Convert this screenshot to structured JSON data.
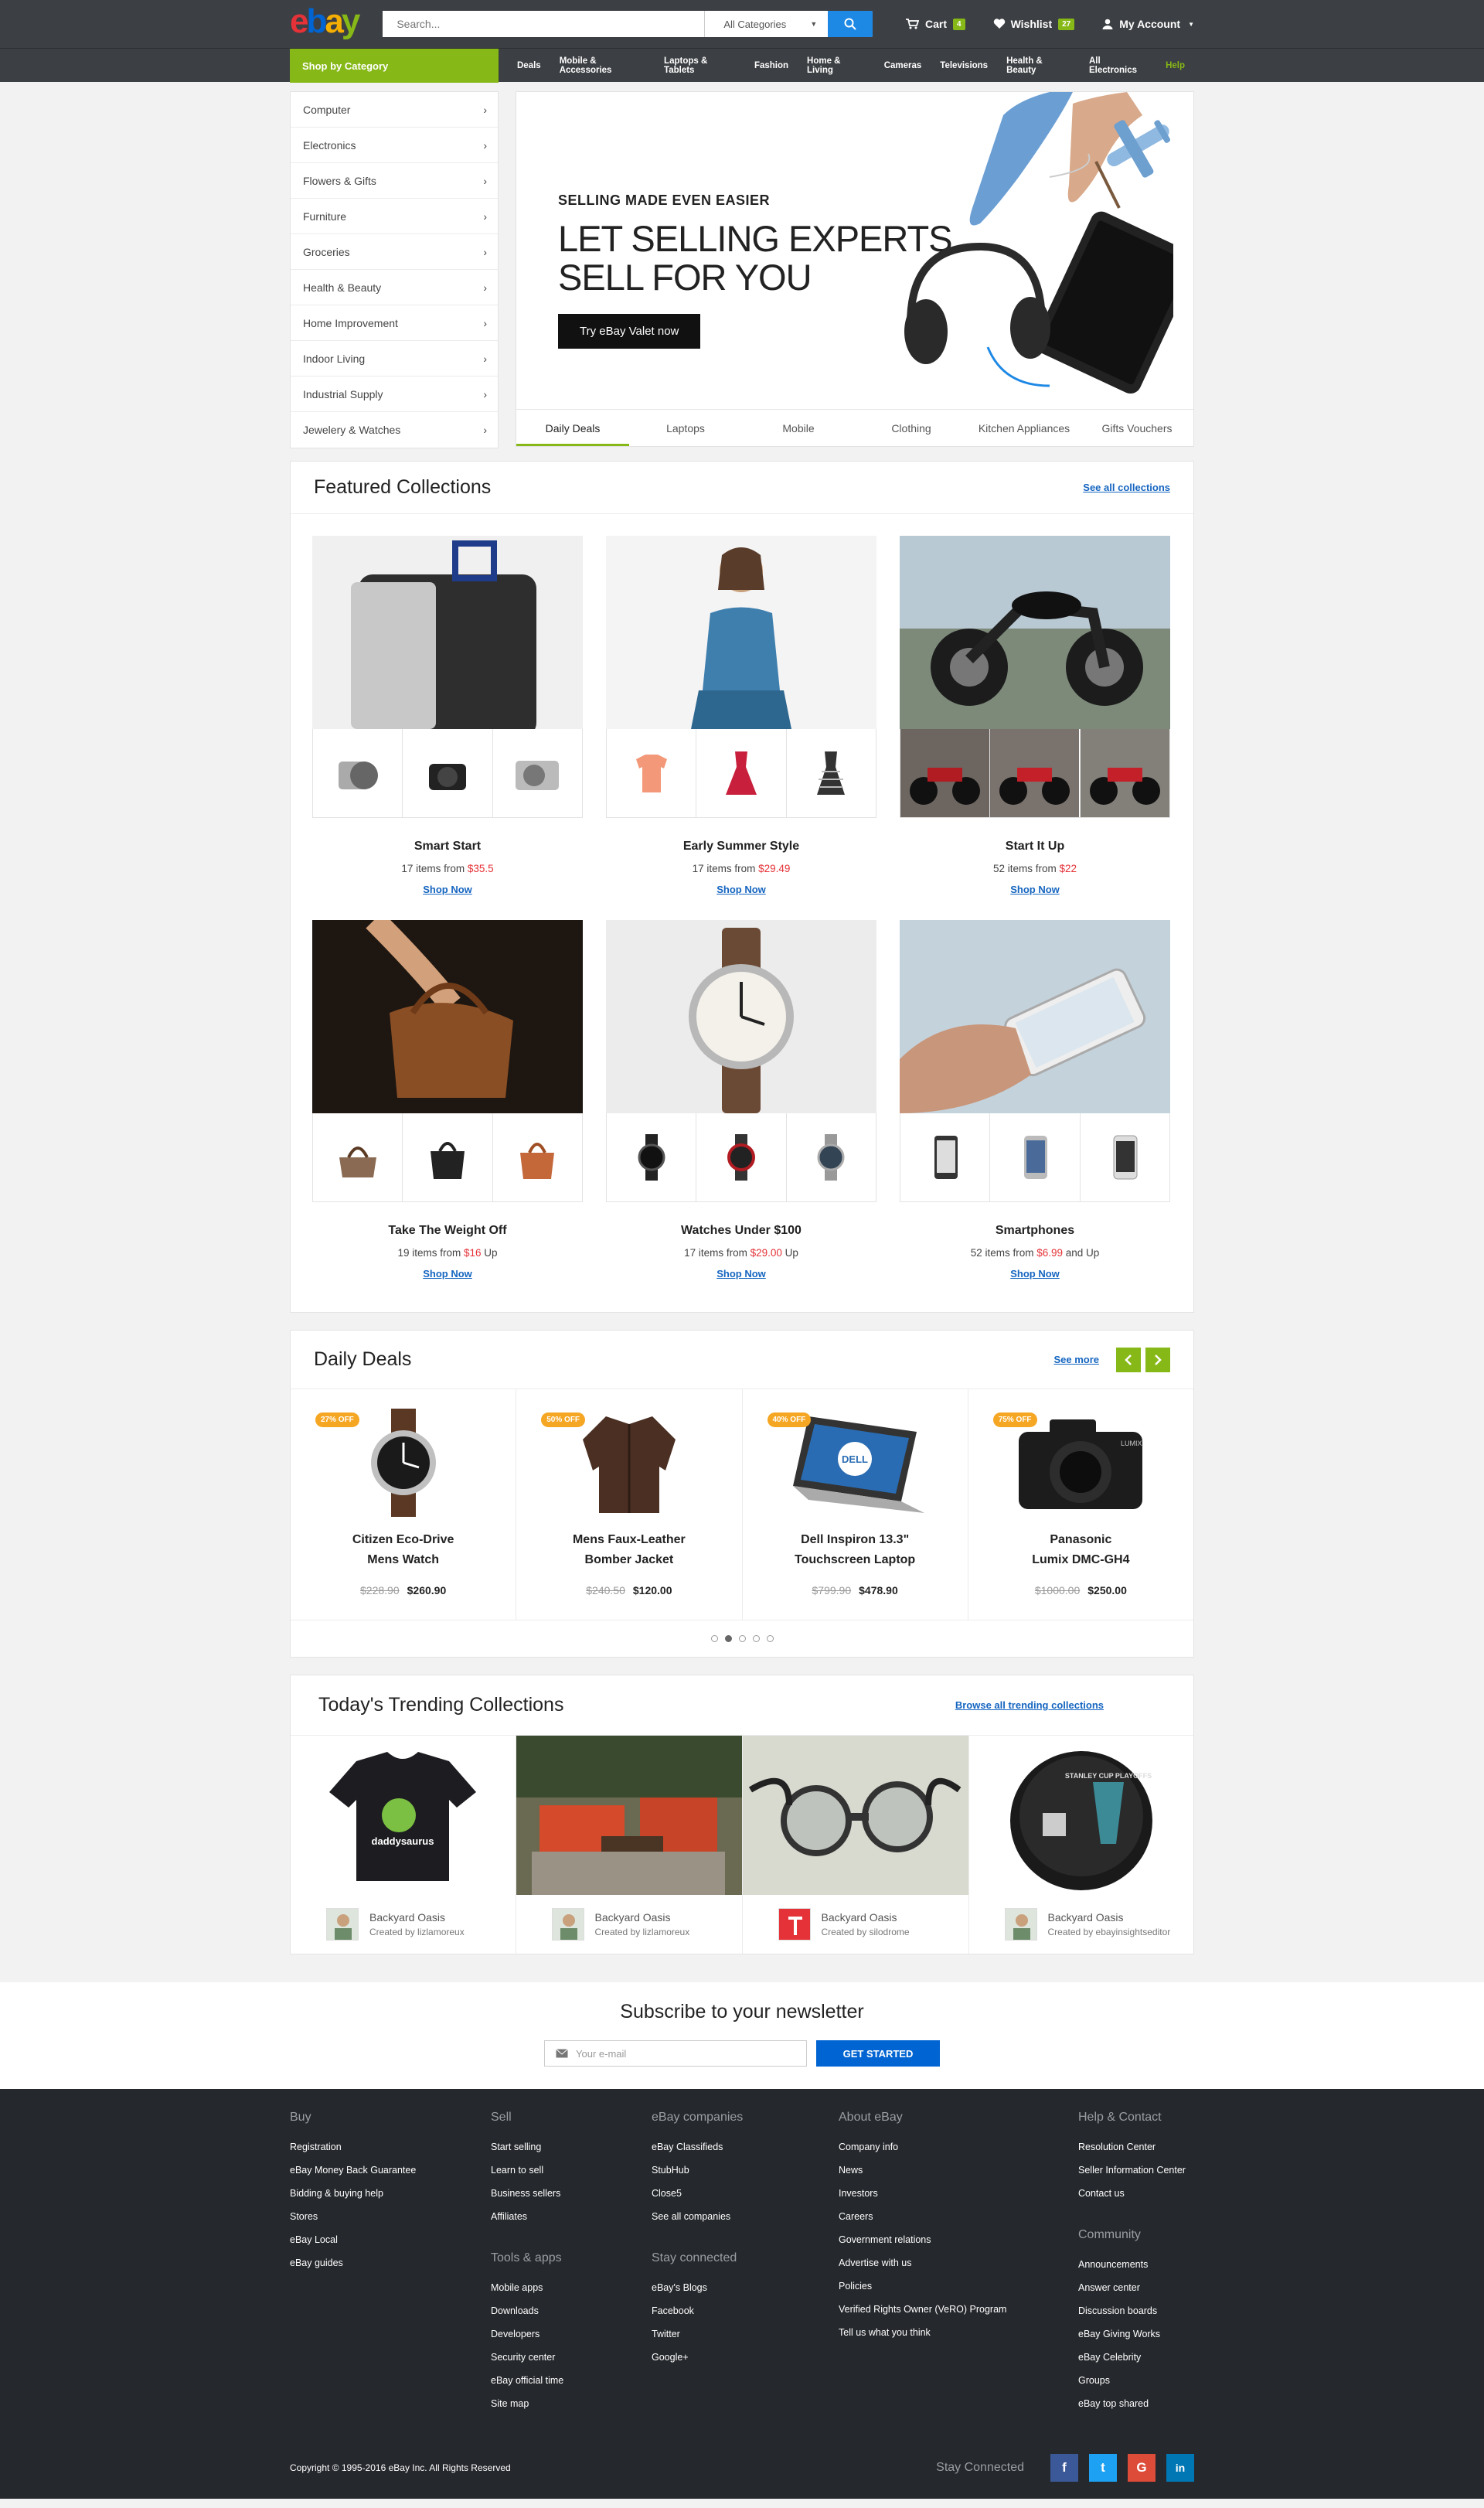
{
  "header": {
    "logo": [
      "e",
      "b",
      "a",
      "y"
    ],
    "search_placeholder": "Search...",
    "category_select": "All Categories",
    "cart_label": "Cart",
    "cart_count": "4",
    "wishlist_label": "Wishlist",
    "wishlist_count": "27",
    "account_label": "My Account"
  },
  "nav": {
    "shop_by_category": "Shop by Category",
    "links": [
      "Deals",
      "Mobile & Accessories",
      "Laptops & Tablets",
      "Fashion",
      "Home & Living",
      "Cameras",
      "Televisions",
      "Health & Beauty",
      "All Electronics"
    ],
    "help": "Help"
  },
  "categories": [
    "Computer",
    "Electronics",
    "Flowers & Gifts",
    "Furniture",
    "Groceries",
    "Health & Beauty",
    "Home Improvement",
    "Indoor Living",
    "Industrial Supply",
    "Jewelery & Watches"
  ],
  "banner": {
    "eyebrow": "SELLING MADE EVEN EASIER",
    "headline_1": "LET SELLING EXPERTS",
    "headline_2": "SELL FOR YOU",
    "cta": "Try eBay Valet now",
    "tabs": [
      "Daily Deals",
      "Laptops",
      "Mobile",
      "Clothing",
      "Kitchen Appliances",
      "Gifts Vouchers"
    ]
  },
  "featured": {
    "title": "Featured Collections",
    "see_all": "See all collections",
    "items": [
      {
        "name": "Smart Start",
        "count": "17 items from ",
        "price": "$35.5",
        "suffix": "",
        "shop": "Shop Now"
      },
      {
        "name": "Early Summer Style",
        "count": "17 items from ",
        "price": "$29.49",
        "suffix": "",
        "shop": "Shop Now"
      },
      {
        "name": "Start It Up",
        "count": "52 items from ",
        "price": "$22",
        "suffix": "",
        "shop": "Shop Now"
      },
      {
        "name": "Take The Weight Off",
        "count": "19 items from ",
        "price": "$16",
        "suffix": " Up",
        "shop": "Shop Now"
      },
      {
        "name": "Watches Under $100",
        "count": "17 items from ",
        "price": "$29.00",
        "suffix": " Up",
        "shop": "Shop Now"
      },
      {
        "name": "Smartphones",
        "count": "52 items from ",
        "price": "$6.99",
        "suffix": " and Up",
        "shop": "Shop Now"
      }
    ]
  },
  "deals": {
    "title": "Daily Deals",
    "see_more": "See more",
    "items": [
      {
        "badge": "27% OFF",
        "name1": "Citizen Eco-Drive",
        "name2": "Mens Watch",
        "old": "$228.90",
        "new": "$260.90"
      },
      {
        "badge": "50% OFF",
        "name1": "Mens Faux-Leather",
        "name2": "Bomber Jacket",
        "old": "$240.50",
        "new": "$120.00"
      },
      {
        "badge": "40% OFF",
        "name1": "Dell Inspiron 13.3\"",
        "name2": "Touchscreen Laptop",
        "old": "$799.90",
        "new": "$478.90"
      },
      {
        "badge": "75% OFF",
        "name1": "Panasonic",
        "name2": "Lumix DMC-GH4",
        "old": "$1000.00",
        "new": "$250.00"
      }
    ],
    "pages": 5,
    "active_page": 2
  },
  "trending": {
    "title": "Today's Trending Collections",
    "browse": "Browse all trending collections",
    "items": [
      {
        "title": "Backyard Oasis",
        "by": "Created by lizlamoreux",
        "tee_text": "daddysaurus"
      },
      {
        "title": "Backyard Oasis",
        "by": "Created by lizlamoreux"
      },
      {
        "title": "Backyard Oasis",
        "by": "Created by silodrome"
      },
      {
        "title": "Backyard Oasis",
        "by": "Created by ebayinsightseditor",
        "puck_text": "STANLEY CUP PLAYOFFS"
      }
    ]
  },
  "dell_logo": "DELL",
  "camera_brand": "LUMIX",
  "newsletter": {
    "title": "Subscribe to your newsletter",
    "placeholder": "Your e-mail",
    "button": "GET STARTED"
  },
  "footer": {
    "buy": {
      "title": "Buy",
      "links": [
        "Registration",
        "eBay Money Back Guarantee",
        "Bidding & buying help",
        "Stores",
        "eBay Local",
        "eBay guides"
      ]
    },
    "sell": {
      "title": "Sell",
      "links": [
        "Start selling",
        "Learn to sell",
        "Business sellers",
        "Affiliates"
      ]
    },
    "tools": {
      "title": "Tools & apps",
      "links": [
        "Mobile apps",
        "Downloads",
        "Developers",
        "Security center",
        "eBay official time",
        "Site map"
      ]
    },
    "companies": {
      "title": "eBay companies",
      "links": [
        "eBay Classifieds",
        "StubHub",
        "Close5",
        "See all companies"
      ]
    },
    "stay": {
      "title": "Stay connected",
      "links": [
        "eBay's Blogs",
        "Facebook",
        "Twitter",
        "Google+"
      ]
    },
    "about": {
      "title": "About eBay",
      "links": [
        "Company info",
        "News",
        "Investors",
        "Careers",
        "Government relations",
        "Advertise with us",
        "Policies",
        "Verified Rights Owner (VeRO) Program",
        "Tell us what you think"
      ]
    },
    "help": {
      "title": "Help & Contact",
      "links": [
        "Resolution Center",
        "Seller Information Center",
        "Contact us"
      ]
    },
    "community": {
      "title": "Community",
      "links": [
        "Announcements",
        "Answer center",
        "Discussion boards",
        "eBay Giving Works",
        "eBay Celebrity",
        "Groups",
        "eBay top shared"
      ]
    },
    "copyright": "Copyright © 1995-2016 eBay Inc. All Rights Reserved",
    "stay_connected": "Stay Connected",
    "social": [
      {
        "label": "f",
        "color": "#3b5998"
      },
      {
        "label": "t",
        "color": "#1da1f2"
      },
      {
        "label": "G",
        "color": "#dd4b39"
      },
      {
        "label": "in",
        "color": "#0077b5"
      }
    ]
  },
  "colors": {
    "brand_green": "#86b817",
    "header_bg": "#3c3f43",
    "link_blue": "#1565c0",
    "price_red": "#e53238",
    "deal_badge": "#f5a623"
  }
}
